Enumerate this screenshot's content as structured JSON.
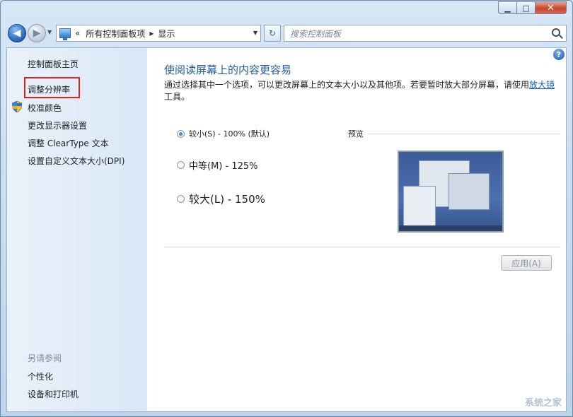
{
  "window": {
    "minimize": "▁",
    "maximize": "□",
    "close": "✕"
  },
  "nav": {
    "back": "◀",
    "forward": "▶",
    "history": "▼",
    "crumb_prefix": "«",
    "crumbs": [
      "所有控制面板项",
      "显示"
    ],
    "sep": "▸",
    "address_drop": "▼",
    "refresh": "↻",
    "search_placeholder": "搜索控制面板"
  },
  "sidebar": {
    "items": [
      {
        "label": "控制面板主页"
      },
      {
        "label": "调整分辨率"
      },
      {
        "label": "校准颜色"
      },
      {
        "label": "更改显示器设置"
      },
      {
        "label": "调整 ClearType 文本"
      },
      {
        "label": "设置自定义文本大小(DPI)"
      }
    ],
    "see_also": "另请参阅",
    "see_also_items": [
      {
        "label": "个性化"
      },
      {
        "label": "设备和打印机"
      }
    ]
  },
  "main": {
    "help": "?",
    "title": "使阅读屏幕上的内容更容易",
    "description_1": "通过选择其中一个选项，可以更改屏幕上的文本大小以及其他项。若要暂时放大部分屏幕，请使用",
    "description_link": "放大镜",
    "description_2": "工具。",
    "options": [
      {
        "label": "较小(S) - 100% (默认)",
        "checked": true
      },
      {
        "label": "中等(M) - 125%",
        "checked": false
      },
      {
        "label": "较大(L) - 150%",
        "checked": false
      }
    ],
    "preview_label": "预览",
    "apply": "应用(A)"
  },
  "watermark": "系统之家",
  "colors": {
    "title": "#1c5ba3",
    "link": "#1660c0",
    "highlight": "#e0241b"
  }
}
